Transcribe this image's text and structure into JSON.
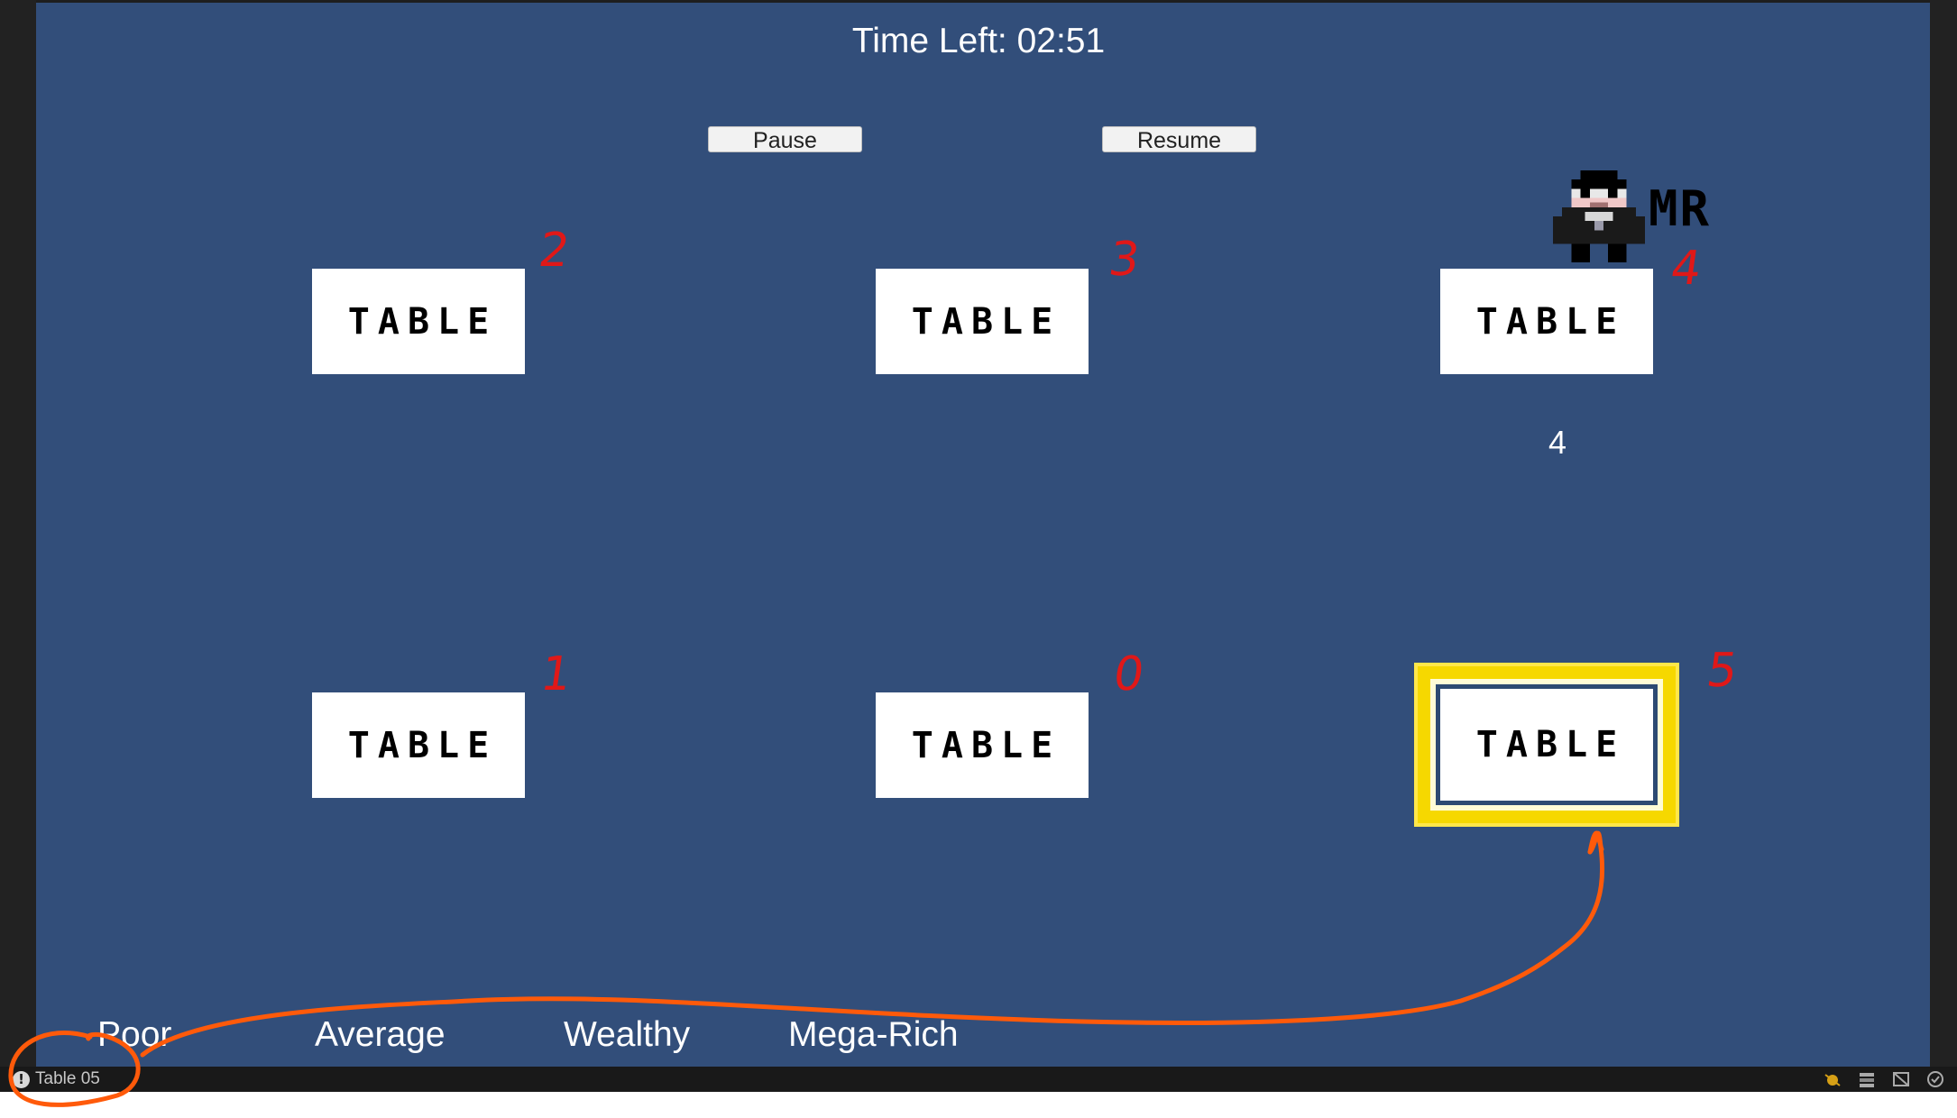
{
  "hud": {
    "timer_text": "Time Left: 02:51",
    "pause_label": "Pause",
    "resume_label": "Resume"
  },
  "tables": [
    {
      "label": "TABLE",
      "annotation": "2"
    },
    {
      "label": "TABLE",
      "annotation": "3"
    },
    {
      "label": "TABLE",
      "annotation": "4",
      "count": "4"
    },
    {
      "label": "TABLE",
      "annotation": "1"
    },
    {
      "label": "TABLE",
      "annotation": "0"
    },
    {
      "label": "TABLE",
      "annotation": "5",
      "selected": true
    }
  ],
  "character": {
    "tag": "MR",
    "icon": "waiter-character-icon"
  },
  "wealth_levels": [
    "Poor",
    "Average",
    "Wealthy",
    "Mega-Rich"
  ],
  "status_bar": {
    "message": "Table 05",
    "icon": "warning-icon"
  },
  "colors": {
    "background": "#324e7a",
    "annotation": "#e01818",
    "highlight": "#f6d800",
    "marker": "#ff5a0a"
  }
}
